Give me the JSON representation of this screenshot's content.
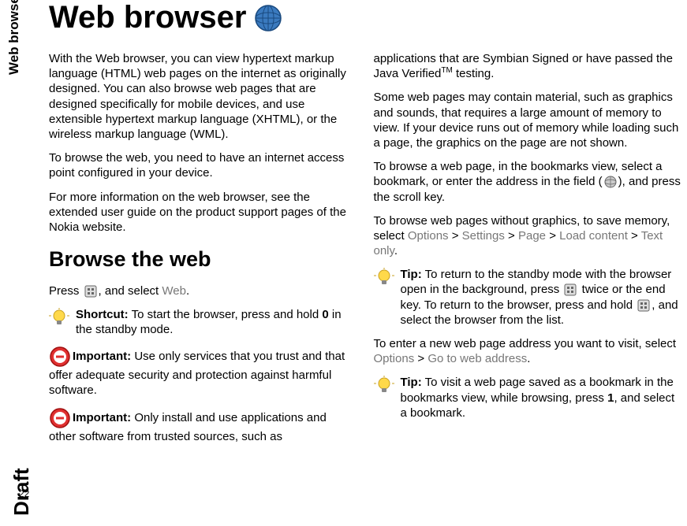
{
  "sidebar": {
    "label": "Web browser",
    "draft": "Draft",
    "pageNumber": "22"
  },
  "title": "Web browser",
  "col1": {
    "p1": "With the Web browser, you can view hypertext markup language (HTML) web pages on the internet as originally designed. You can also browse web pages that are designed specifically for mobile devices, and use extensible hypertext markup language (XHTML), or the wireless markup language (WML).",
    "p2": "To browse the web, you need to have an internet access point configured in your device.",
    "p3": "For more information on the web browser, see the extended user guide on the product support pages of the Nokia website.",
    "h2": "Browse the web",
    "press": "Press ",
    "selectWeb1": ", and select ",
    "web": "Web",
    "selectWeb2": ".",
    "shortcutLabel": "Shortcut:",
    "shortcutText1": " To start the browser, press and hold ",
    "zero": "0",
    "shortcutText2": " in the standby mode.",
    "important1Label": "Important: ",
    "important1Text": " Use only services that you trust and that offer adequate security and protection against harmful software.",
    "important2Label": "Important: ",
    "important2Text": " Only install and use applications and other software from trusted sources, such as"
  },
  "col2": {
    "p1a": "applications that are Symbian Signed or have passed the Java Verified",
    "p1b": " testing.",
    "p2": "Some web pages may contain material, such as graphics and sounds, that requires a large amount of memory to view. If your device runs out of memory while loading such a page, the graphics on the page are not shown.",
    "p3a": "To browse a web page, in the bookmarks view, select a bookmark, or enter the address in the field (",
    "p3b": "), and press the scroll key.",
    "p4a": "To browse web pages without graphics, to save memory, select ",
    "options": "Options",
    "gt": " > ",
    "settings": "Settings",
    "page": "Page",
    "loadcontent": "Load content",
    "textonly": "Text only",
    "dot": ".",
    "tipLabel": "Tip:",
    "tip1a": " To return to the standby mode with the browser open in the background, press ",
    "tip1b": " twice or the end key. To return to the browser, press and hold ",
    "tip1c": ", and select the browser from the list.",
    "p5a": "To enter a new web page address you want to visit, select ",
    "gotoweb": "Go to web address",
    "tip2Label": "Tip:",
    "tip2a": " To visit a web page saved as a bookmark in the bookmarks view, while browsing, press ",
    "one": "1",
    "tip2b": ", and select a bookmark."
  }
}
